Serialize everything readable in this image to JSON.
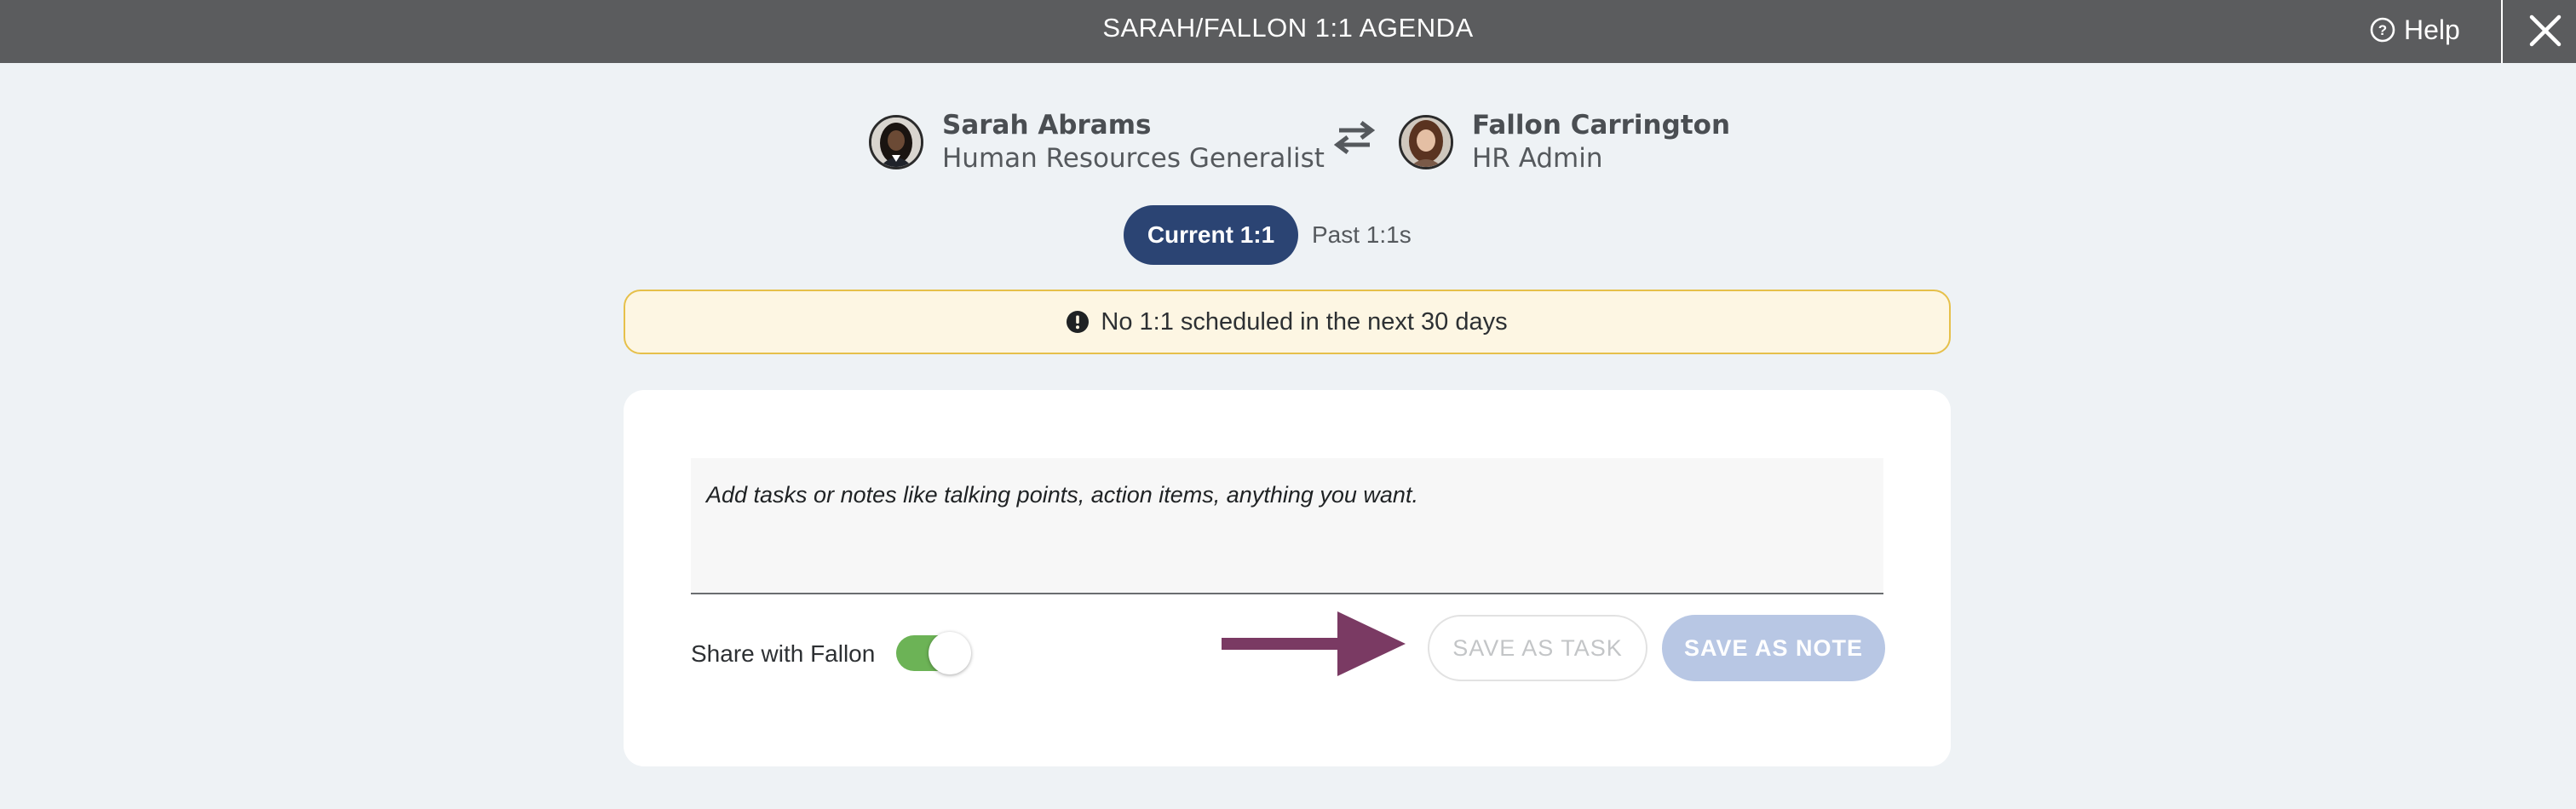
{
  "header": {
    "title": "SARAH/FALLON 1:1 AGENDA",
    "help_label": "Help",
    "help_icon": "question-circle-icon",
    "close_icon": "close-icon"
  },
  "participants": {
    "manager": {
      "name": "Sarah Abrams",
      "role": "Human Resources Generalist"
    },
    "swap_icon": "swap-arrows-icon",
    "employee": {
      "name": "Fallon Carrington",
      "role": "HR Admin"
    }
  },
  "tabs": {
    "current": "Current 1:1",
    "past": "Past 1:1s",
    "active": "current"
  },
  "alert": {
    "icon": "exclamation-circle-icon",
    "text": "No 1:1 scheduled in the next 30 days"
  },
  "composer": {
    "placeholder": "Add tasks or notes like talking points, action items, anything you want.",
    "value": "",
    "share_label": "Share with Fallon",
    "share_enabled": true,
    "save_task_label": "SAVE AS TASK",
    "save_note_label": "SAVE AS NOTE"
  },
  "colors": {
    "topbar": "#5b5c5e",
    "active_tab": "#2b4473",
    "toggle_on": "#6cb356",
    "arrow": "#7a3a63",
    "alert_border": "#e6c04a",
    "save_note_button": "#b8c7e4"
  }
}
